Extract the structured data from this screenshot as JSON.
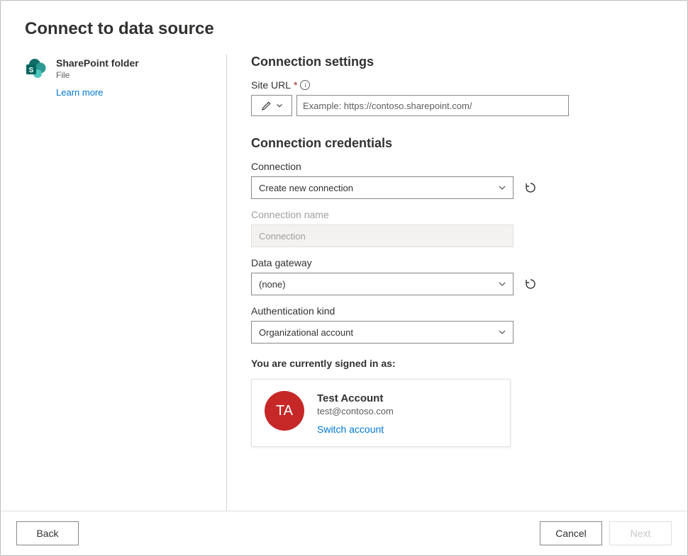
{
  "title": "Connect to data source",
  "source": {
    "name": "SharePoint folder",
    "subtype": "File",
    "learn_more": "Learn more"
  },
  "settings": {
    "heading": "Connection settings",
    "site_url": {
      "label": "Site URL",
      "placeholder": "Example: https://contoso.sharepoint.com/"
    }
  },
  "credentials": {
    "heading": "Connection credentials",
    "connection": {
      "label": "Connection",
      "value": "Create new connection"
    },
    "connection_name": {
      "label": "Connection name",
      "value": "Connection"
    },
    "data_gateway": {
      "label": "Data gateway",
      "value": "(none)"
    },
    "auth_kind": {
      "label": "Authentication kind",
      "value": "Organizational account"
    }
  },
  "signed_in": {
    "label": "You are currently signed in as:",
    "initials": "TA",
    "name": "Test Account",
    "email": "test@contoso.com",
    "switch": "Switch account"
  },
  "footer": {
    "back": "Back",
    "cancel": "Cancel",
    "next": "Next"
  }
}
